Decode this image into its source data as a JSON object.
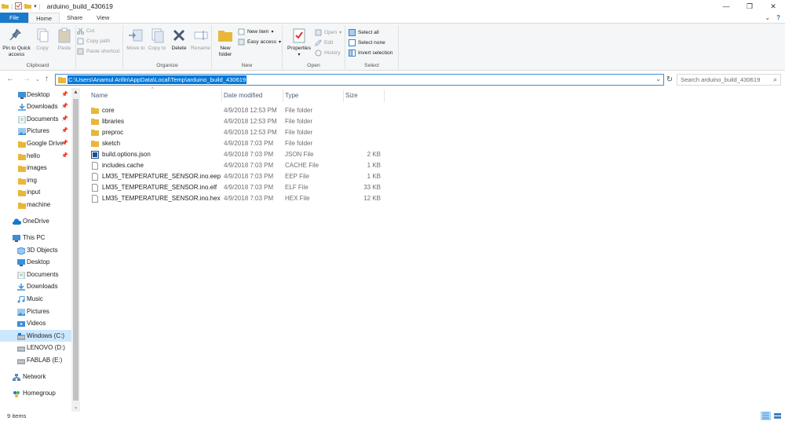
{
  "window": {
    "title": "arduino_build_430619",
    "controls": [
      "minimize",
      "maximize",
      "close"
    ]
  },
  "tabs": [
    {
      "label": "File"
    },
    {
      "label": "Home"
    },
    {
      "label": "Share"
    },
    {
      "label": "View"
    }
  ],
  "ribbon": {
    "clipboard": {
      "label": "Clipboard",
      "pin": "Pin to Quick access",
      "copy": "Copy",
      "paste": "Paste",
      "cut": "Cut",
      "copy_path": "Copy path",
      "paste_shortcut": "Paste shortcut"
    },
    "organize": {
      "label": "Organize",
      "move_to": "Move to",
      "copy_to": "Copy to",
      "delete": "Delete",
      "rename": "Rename"
    },
    "new": {
      "label": "New",
      "new_folder": "New folder",
      "new_item": "New item",
      "easy_access": "Easy access"
    },
    "open": {
      "label": "Open",
      "properties": "Properties",
      "open": "Open",
      "edit": "Edit",
      "history": "History"
    },
    "select": {
      "label": "Select",
      "select_all": "Select all",
      "select_none": "Select none",
      "invert_selection": "Invert selection"
    }
  },
  "address": {
    "path": "C:\\Users\\Anamul Arifin\\AppData\\Local\\Temp\\arduino_build_430619",
    "search_placeholder": "Search arduino_build_430619"
  },
  "nav": {
    "quick_access": [
      {
        "label": "Desktop",
        "icon": "desktop-icon",
        "pinned": true
      },
      {
        "label": "Downloads",
        "icon": "downloads-icon",
        "pinned": true
      },
      {
        "label": "Documents",
        "icon": "documents-icon",
        "pinned": true
      },
      {
        "label": "Pictures",
        "icon": "pictures-icon",
        "pinned": true
      },
      {
        "label": "Google Drive",
        "icon": "folder-icon",
        "pinned": true
      },
      {
        "label": "hello",
        "icon": "folder-icon",
        "pinned": true
      },
      {
        "label": "images",
        "icon": "folder-icon",
        "pinned": false
      },
      {
        "label": "img",
        "icon": "folder-icon",
        "pinned": false
      },
      {
        "label": "input",
        "icon": "folder-icon",
        "pinned": false
      },
      {
        "label": "machine",
        "icon": "folder-icon",
        "pinned": false
      }
    ],
    "onedrive": "OneDrive",
    "this_pc": "This PC",
    "pc_items": [
      {
        "label": "3D Objects",
        "icon": "3d-objects-icon"
      },
      {
        "label": "Desktop",
        "icon": "desktop-icon"
      },
      {
        "label": "Documents",
        "icon": "documents-icon"
      },
      {
        "label": "Downloads",
        "icon": "downloads-icon"
      },
      {
        "label": "Music",
        "icon": "music-icon"
      },
      {
        "label": "Pictures",
        "icon": "pictures-icon"
      },
      {
        "label": "Videos",
        "icon": "videos-icon"
      },
      {
        "label": "Windows (C:)",
        "icon": "drive-c-icon",
        "selected": true
      },
      {
        "label": "LENOVO (D:)",
        "icon": "drive-icon"
      },
      {
        "label": "FABLAB (E:)",
        "icon": "drive-icon"
      }
    ],
    "network": "Network",
    "homegroup": "Homegroup"
  },
  "columns": {
    "name": "Name",
    "date": "Date modified",
    "type": "Type",
    "size": "Size"
  },
  "files": [
    {
      "name": "core",
      "date": "4/9/2018 12:53 PM",
      "type": "File folder",
      "size": "",
      "icon": "folder-icon"
    },
    {
      "name": "libraries",
      "date": "4/9/2018 12:53 PM",
      "type": "File folder",
      "size": "",
      "icon": "folder-icon"
    },
    {
      "name": "preproc",
      "date": "4/9/2018 12:53 PM",
      "type": "File folder",
      "size": "",
      "icon": "folder-icon"
    },
    {
      "name": "sketch",
      "date": "4/9/2018 7:03 PM",
      "type": "File folder",
      "size": "",
      "icon": "folder-icon"
    },
    {
      "name": "build.options.json",
      "date": "4/9/2018 7:03 PM",
      "type": "JSON File",
      "size": "2 KB",
      "icon": "json-file-icon"
    },
    {
      "name": "includes.cache",
      "date": "4/9/2018 7:03 PM",
      "type": "CACHE File",
      "size": "1 KB",
      "icon": "file-icon"
    },
    {
      "name": "LM35_TEMPERATURE_SENSOR.ino.eep",
      "date": "4/9/2018 7:03 PM",
      "type": "EEP File",
      "size": "1 KB",
      "icon": "file-icon"
    },
    {
      "name": "LM35_TEMPERATURE_SENSOR.ino.elf",
      "date": "4/9/2018 7:03 PM",
      "type": "ELF File",
      "size": "33 KB",
      "icon": "file-icon"
    },
    {
      "name": "LM35_TEMPERATURE_SENSOR.ino.hex",
      "date": "4/9/2018 7:03 PM",
      "type": "HEX File",
      "size": "12 KB",
      "icon": "file-icon"
    }
  ],
  "status": {
    "item_count": "9 items"
  },
  "colors": {
    "accent": "#0078d7",
    "file_tab": "#1979ca",
    "folder": "#e8b73a",
    "selection": "#cce8ff"
  }
}
